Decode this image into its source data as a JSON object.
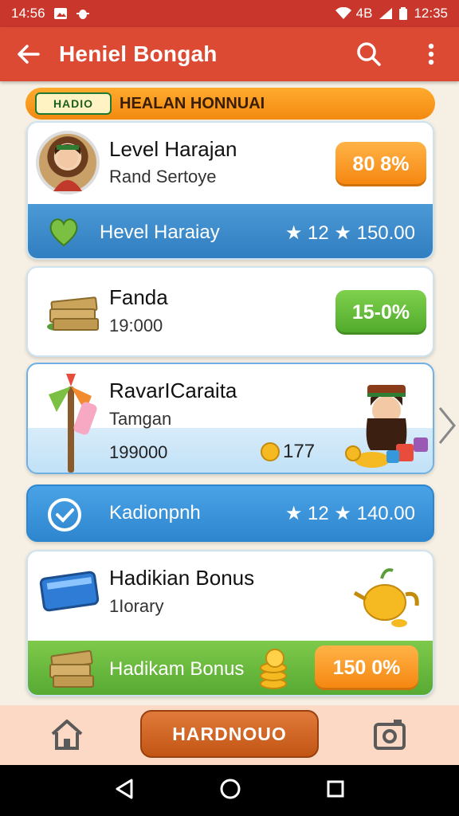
{
  "status_bar": {
    "time_left": "14:56",
    "carrier": "4B",
    "time_right": "12:35"
  },
  "app_bar": {
    "title": "Heniel Bongah"
  },
  "banner": {
    "badge": "HADIO",
    "title": "HEALAN HONNUAI"
  },
  "cards": [
    {
      "title": "Level Harajan",
      "subtitle": "Rand Sertoye",
      "pill": "80 8%",
      "strip_label": "Hevel Haraiay",
      "strip_value": "★ 12 ★ 150.00"
    },
    {
      "title": "Fanda",
      "subtitle": "19:000",
      "pill": "15-0%"
    },
    {
      "title": "RavarICaraita",
      "subtitle": "Tamgan",
      "amount": "199000",
      "coin_value": "177"
    },
    {
      "title": "Hadikian Bonus",
      "subtitle": "1Iorary",
      "strip_label": "Hadikam Bonus",
      "pill": "150 0%"
    }
  ],
  "blue_bar": {
    "label": "Kadionpnh",
    "value": "★ 12 ★ 140.00"
  },
  "bottom": {
    "button_label": "HARDNOUO"
  },
  "colors": {
    "header": "#dc4a34",
    "status": "#c9372c",
    "orange": "#f5850e",
    "green": "#4fa82a",
    "blue": "#2f7cbf",
    "bottom_bg": "#fbd9c4"
  },
  "icons": [
    "back-arrow-icon",
    "search-icon",
    "more-vert-icon",
    "heart-icon",
    "star-icon",
    "coin-icon",
    "check-circle-icon",
    "home-icon",
    "camera-icon",
    "chevron-right-icon",
    "nav-back-icon",
    "nav-home-icon",
    "nav-recents-icon"
  ]
}
